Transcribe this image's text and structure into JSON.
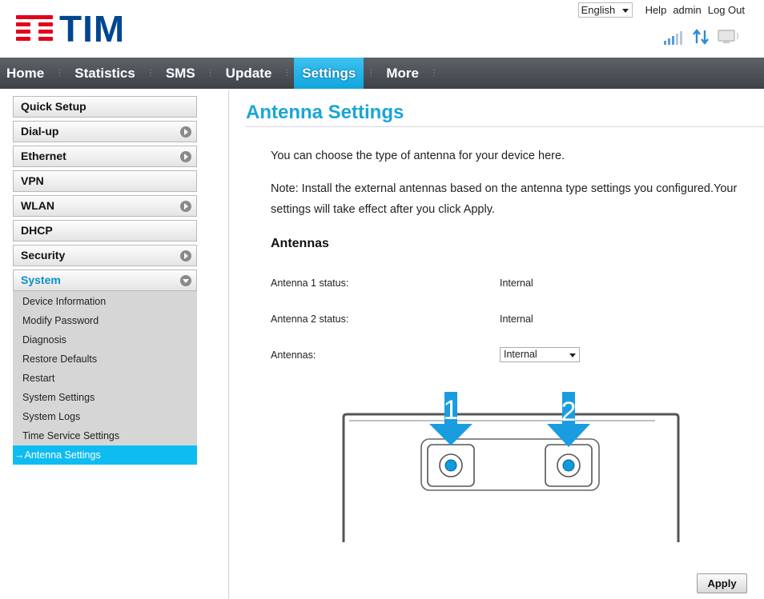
{
  "brand": {
    "logo_text": "TIM",
    "colors": {
      "logo_red": "#e2001a",
      "logo_blue": "#004691",
      "accent": "#1aa5d8"
    }
  },
  "top_bar": {
    "language": "English",
    "links": {
      "help": "Help",
      "user": "admin",
      "logout": "Log Out"
    }
  },
  "status_icons": [
    "signal-strength-icon",
    "data-transfer-icon",
    "monitor-icon"
  ],
  "nav": {
    "items": [
      {
        "label": "Home"
      },
      {
        "label": "Statistics"
      },
      {
        "label": "SMS"
      },
      {
        "label": "Update"
      },
      {
        "label": "Settings",
        "active": true
      },
      {
        "label": "More"
      }
    ]
  },
  "sidebar": {
    "items": [
      {
        "label": "Quick Setup"
      },
      {
        "label": "Dial-up"
      },
      {
        "label": "Ethernet"
      },
      {
        "label": "VPN"
      },
      {
        "label": "WLAN"
      },
      {
        "label": "DHCP"
      },
      {
        "label": "Security"
      },
      {
        "label": "System"
      }
    ],
    "system_submenu": [
      {
        "label": "Device Information"
      },
      {
        "label": "Modify Password"
      },
      {
        "label": "Diagnosis"
      },
      {
        "label": "Restore Defaults"
      },
      {
        "label": "Restart"
      },
      {
        "label": "System Settings"
      },
      {
        "label": "System Logs"
      },
      {
        "label": "Time Service Settings"
      },
      {
        "label": "Antenna Settings",
        "active": true
      }
    ],
    "active_marker": "→"
  },
  "main": {
    "title": "Antenna Settings",
    "intro": "You can choose the type of antenna for your device here.",
    "note": "Note: Install the external antennas based on the antenna type settings you configured.Your settings will take effect after you click Apply.",
    "section_title": "Antennas",
    "fields": {
      "antenna1": {
        "label": "Antenna 1 status:",
        "value": "Internal"
      },
      "antenna2": {
        "label": "Antenna 2 status:",
        "value": "Internal"
      },
      "antennas": {
        "label": "Antennas:",
        "value": "Internal"
      }
    },
    "diagram": {
      "port1_label": "1",
      "port2_label": "2"
    },
    "apply_label": "Apply"
  }
}
